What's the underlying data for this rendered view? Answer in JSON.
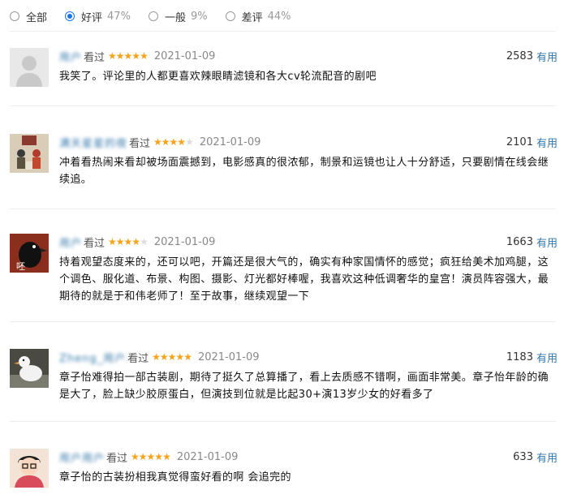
{
  "filters": [
    {
      "label": "全部",
      "pct": "",
      "checked": false
    },
    {
      "label": "好评",
      "pct": "47%",
      "checked": true
    },
    {
      "label": "一般",
      "pct": "9%",
      "checked": false
    },
    {
      "label": "差评",
      "pct": "44%",
      "checked": false
    }
  ],
  "comments": [
    {
      "user": "用户",
      "watched": "看过",
      "rating": 5,
      "date": "2021-01-09",
      "votes": "2583",
      "useful": "有用",
      "text": "我笑了。评论里的人都更喜欢辣眼睛滤镜和各大cv轮流配音的剧吧"
    },
    {
      "user": "满天星星的夜",
      "watched": "看过",
      "rating": 4,
      "date": "2021-01-09",
      "votes": "2101",
      "useful": "有用",
      "text": "冲着看热闹来看却被场面震撼到，电影感真的很浓郁，制景和运镜也让人十分舒适，只要剧情在线会继续追。"
    },
    {
      "user": "用户",
      "watched": "看过",
      "rating": 4,
      "date": "2021-01-09",
      "votes": "1663",
      "useful": "有用",
      "text": "持着观望态度来的，还可以吧，开篇还是很大气的，确实有种家国情怀的感觉；疯狂给美术加鸡腿，这个调色、服化道、布景、构图、摄影、灯光都好棒喔，我喜欢这种低调奢华的皇宫！演员阵容强大，最期待的就是于和伟老师了！至于故事，继续观望一下"
    },
    {
      "user": "Zheng_用户",
      "watched": "看过",
      "rating": 5,
      "date": "2021-01-09",
      "votes": "1183",
      "useful": "有用",
      "text": "章子怡难得拍一部古装剧，期待了挺久了总算播了，看上去质感不错啊，画面非常美。章子怡年龄的确是大了，脸上缺少胶原蛋白，但演技到位就是比起30+演13岁少女的好看多了"
    },
    {
      "user": "用户用户",
      "watched": "看过",
      "rating": 5,
      "date": "2021-01-09",
      "votes": "633",
      "useful": "有用",
      "text": "章子怡的古装扮相我真觉得蛮好看的啊 会追完的"
    }
  ]
}
